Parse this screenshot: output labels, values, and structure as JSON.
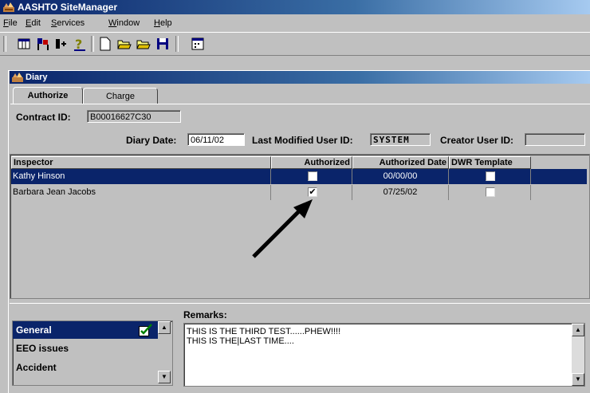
{
  "app": {
    "title": "AASHTO SiteManager"
  },
  "menu": [
    {
      "label": "File",
      "accel": "F",
      "rest": "ile"
    },
    {
      "label": "Edit",
      "accel": "E",
      "rest": "dit"
    },
    {
      "label": "Services",
      "accel": "S",
      "rest": "ervices"
    },
    {
      "label": "Window",
      "accel": "W",
      "rest": "indow"
    },
    {
      "label": "Help",
      "accel": "H",
      "rest": "elp"
    }
  ],
  "toolbar_icons": [
    "grid-icon",
    "flags-icon",
    "transfer-icon",
    "help-icon",
    "new-document-icon",
    "open-folder-icon",
    "open-folder-2-icon",
    "save-icon",
    "calendar-icon"
  ],
  "window": {
    "title": "Diary"
  },
  "tabs": [
    {
      "label": "Authorize"
    },
    {
      "label": "Charge"
    }
  ],
  "form": {
    "contract_label": "Contract ID:",
    "contract_value": "B00016627C30",
    "diary_date_label": "Diary Date:",
    "diary_date_value": "06/11/02",
    "last_modified_label": "Last Modified User ID:",
    "last_modified_value": "SYSTEM",
    "creator_label": "Creator User ID:",
    "creator_value": ""
  },
  "grid": {
    "columns": [
      "Inspector",
      "Authorized",
      "Authorized Date",
      "DWR Template"
    ],
    "rows": [
      {
        "inspector": "Kathy Hinson",
        "authorized": false,
        "authorized_date": "00/00/00",
        "dwr_template": false,
        "selected": true
      },
      {
        "inspector": "Barbara Jean Jacobs",
        "authorized": true,
        "authorized_date": "07/25/02",
        "dwr_template": false,
        "selected": false
      }
    ],
    "checkmark": "✔"
  },
  "sections": [
    {
      "label": "General",
      "selected": true
    },
    {
      "label": "EEO issues",
      "selected": false
    },
    {
      "label": "Accident",
      "selected": false
    }
  ],
  "remarks": {
    "label": "Remarks:",
    "line1": "THIS IS THE THIRD TEST......PHEW!!!!",
    "line2": "THIS IS THE|LAST TIME...."
  },
  "colors": {
    "title_bar": "#0a246a",
    "selection": "#0a246a",
    "face": "#c0c0c0"
  }
}
